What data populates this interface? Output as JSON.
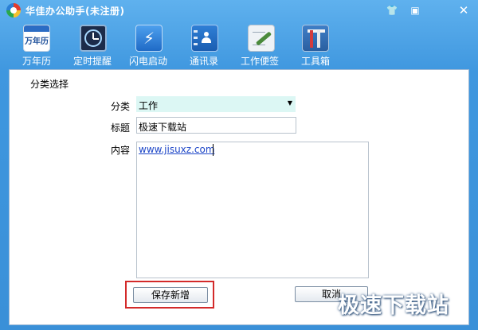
{
  "window": {
    "title": "华佳办公助手(未注册)",
    "controls": {
      "skin": "👕",
      "minimize": "▣",
      "close": "✕"
    }
  },
  "toolbar": {
    "items": [
      {
        "label": "万年历",
        "icon": "calendar-icon",
        "icon_text": "万年历"
      },
      {
        "label": "定时提醒",
        "icon": "clock-icon"
      },
      {
        "label": "闪电启动",
        "icon": "lightning-icon",
        "icon_text": "⚡"
      },
      {
        "label": "通讯录",
        "icon": "contacts-icon"
      },
      {
        "label": "工作便签",
        "icon": "notepad-icon"
      },
      {
        "label": "工具箱",
        "icon": "toolbox-icon"
      }
    ]
  },
  "panel": {
    "section_title": "分类选择",
    "category": {
      "label": "分类",
      "value": "工作",
      "arrow": "▼"
    },
    "title_field": {
      "label": "标题",
      "value": "极速下载站"
    },
    "content_field": {
      "label": "内容",
      "value": "www.jisuxz.com"
    },
    "buttons": {
      "save": "保存新增",
      "cancel": "取消"
    }
  },
  "watermark": "极速下载站",
  "colors": {
    "title_bar": "#3f97df",
    "highlight": "#d32a2a",
    "select_bg": "#dcf7f4",
    "link": "#1e47c8"
  }
}
